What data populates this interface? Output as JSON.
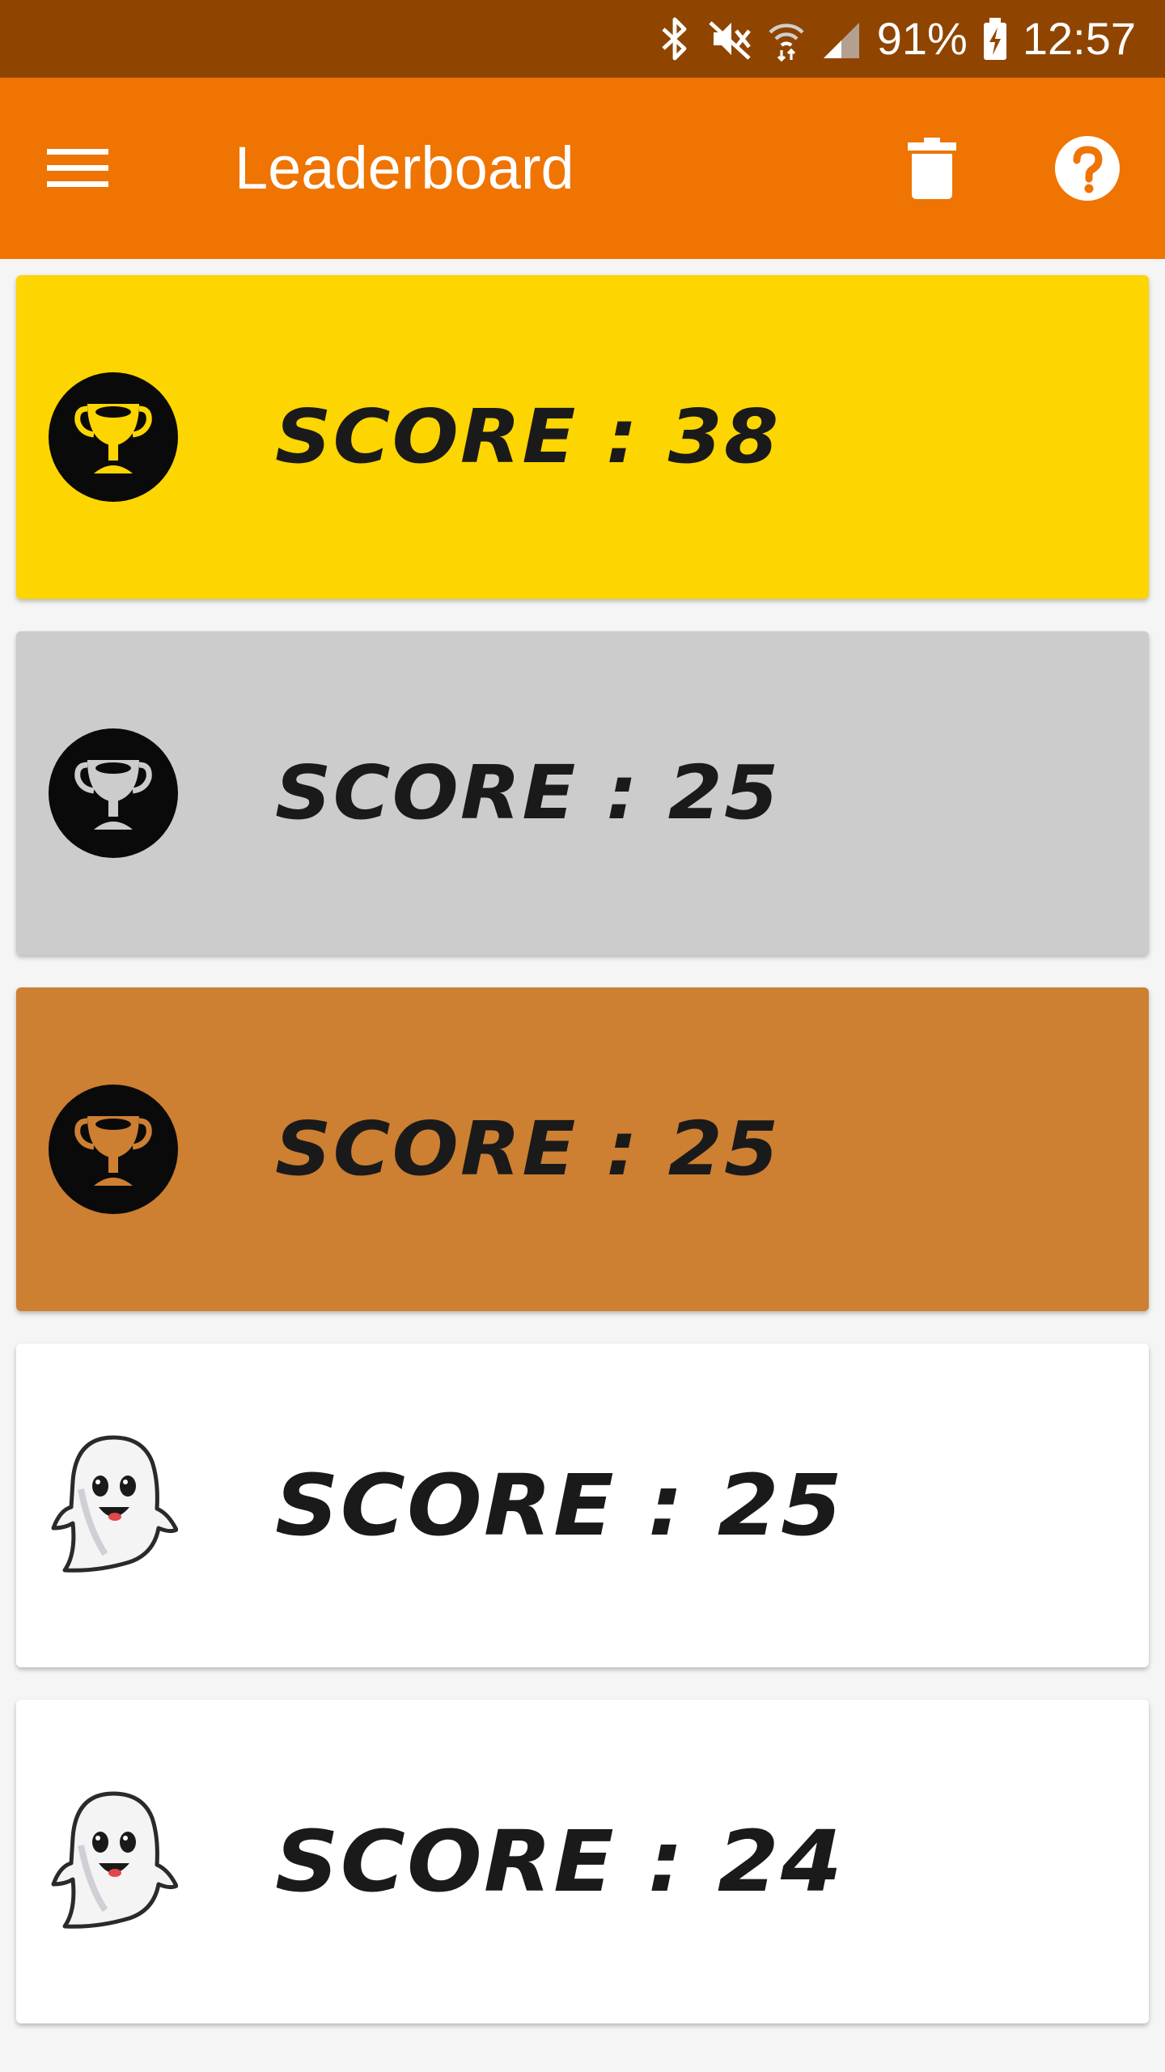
{
  "status_bar": {
    "battery": "91%",
    "time": "12:57"
  },
  "app_bar": {
    "title": "Leaderboard",
    "icons": {
      "menu": "menu-icon",
      "delete": "trash-icon",
      "help": "help-icon"
    }
  },
  "colors": {
    "status_bar": "#8f4500",
    "app_bar": "#ef7402",
    "gold": "#fdd500",
    "silver": "#cccccc",
    "bronze": "#cd7f32",
    "plain": "#ffffff"
  },
  "entries": [
    {
      "label": "SCORE : 38",
      "icon": "trophy-gold-icon"
    },
    {
      "label": "SCORE : 25",
      "icon": "trophy-silver-icon"
    },
    {
      "label": "SCORE : 25",
      "icon": "trophy-bronze-icon"
    },
    {
      "label": "SCORE : 25",
      "icon": "ghost-icon"
    },
    {
      "label": "SCORE : 24",
      "icon": "ghost-icon"
    }
  ]
}
